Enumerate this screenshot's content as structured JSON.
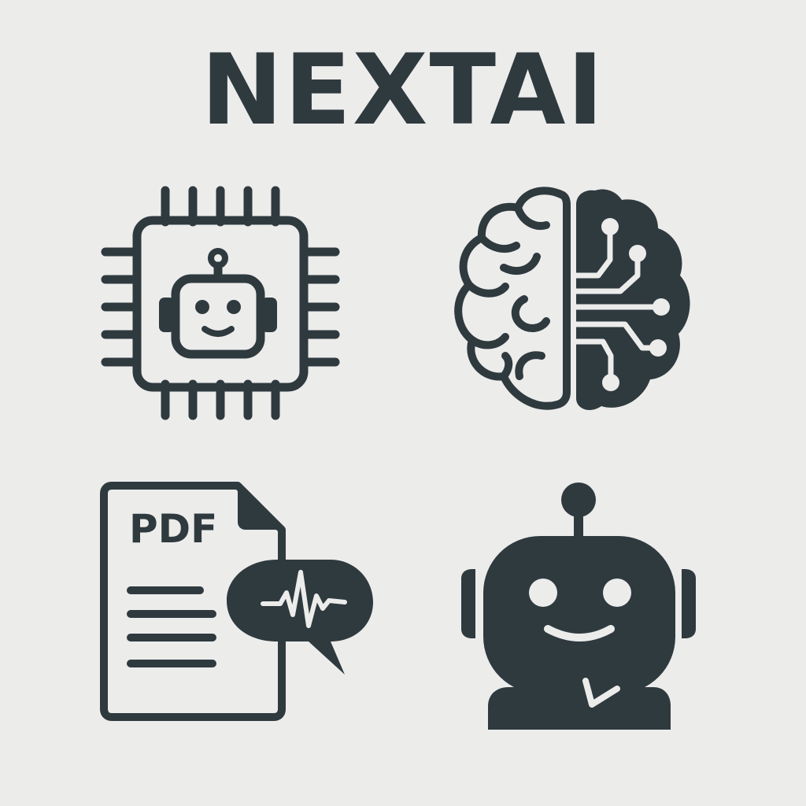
{
  "title": "NEXTAI",
  "colors": {
    "background": "#ececeb",
    "ink": "#2f3a3f"
  },
  "icons": {
    "chip": "chip-robot-icon",
    "brain": "brain-circuit-icon",
    "document": "pdf-document-chat-icon",
    "bot": "chatbot-icon"
  },
  "document_badge": "PDF"
}
